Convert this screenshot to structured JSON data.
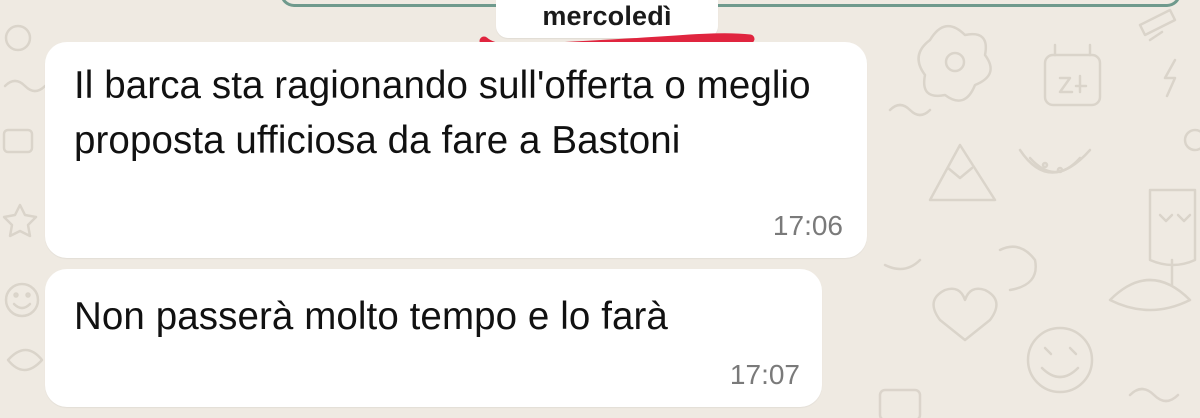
{
  "chat": {
    "date_separator": "mercoledì",
    "messages": [
      {
        "text": "Il barca sta ragionando sull'offerta o meglio proposta ufficiosa da fare a Bastoni",
        "time": "17:06"
      },
      {
        "text": "Non passerà molto tempo e lo farà",
        "time": "17:07"
      }
    ]
  },
  "colors": {
    "background": "#efeae2",
    "bubble": "#ffffff",
    "accent_bar": "#6f9a8d",
    "underline": "#e0253f"
  },
  "icons": [
    "doodle-wallpaper-icons"
  ]
}
